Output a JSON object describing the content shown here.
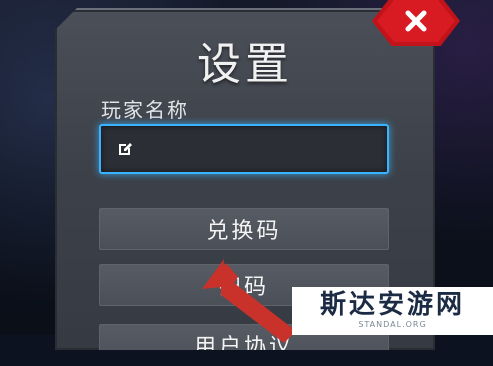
{
  "dialog": {
    "title": "设置",
    "name_label": "玩家名称",
    "name_value": ""
  },
  "menu": {
    "redeem_label": "兑换码",
    "scan_label": "扫码",
    "user_label": "用户协议"
  },
  "watermark": {
    "name_cn": "斯达安游网",
    "domain": "STANDAL.ORG"
  },
  "colors": {
    "accent_blue": "#39b3ff",
    "close_red": "#d81b22",
    "arrow_red": "#c8322a",
    "panel_gray": "#3d4149"
  },
  "icons": {
    "close": "close-icon",
    "edit": "edit-icon",
    "annotation": "arrow-annotation"
  }
}
